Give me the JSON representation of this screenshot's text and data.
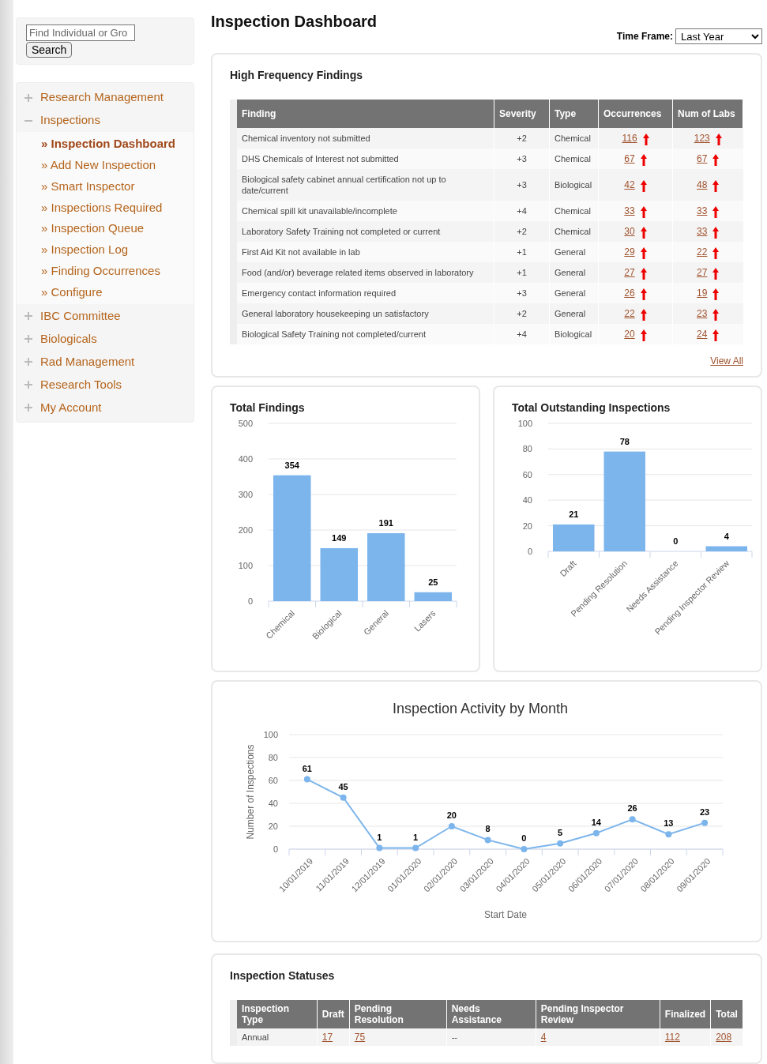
{
  "search": {
    "placeholder": "Find Individual or Gro",
    "button": "Search"
  },
  "sidebar": {
    "items": [
      {
        "label": "Research Management",
        "expanded": false
      },
      {
        "label": "Inspections",
        "expanded": true,
        "children": [
          {
            "label": "» Inspection Dashboard",
            "selected": true
          },
          {
            "label": "» Add New Inspection",
            "selected": false
          },
          {
            "label": "» Smart Inspector",
            "selected": false
          },
          {
            "label": "» Inspections Required",
            "selected": false
          },
          {
            "label": "» Inspection Queue",
            "selected": false
          },
          {
            "label": "» Inspection Log",
            "selected": false
          },
          {
            "label": "» Finding Occurrences",
            "selected": false
          },
          {
            "label": "» Configure",
            "selected": false
          }
        ]
      },
      {
        "label": "IBC Committee",
        "expanded": false
      },
      {
        "label": "Biologicals",
        "expanded": false
      },
      {
        "label": "Rad Management",
        "expanded": false
      },
      {
        "label": "Research Tools",
        "expanded": false
      },
      {
        "label": "My Account",
        "expanded": false
      }
    ]
  },
  "page_title": "Inspection Dashboard",
  "time_frame": {
    "label": "Time Frame:",
    "value": "Last Year"
  },
  "findings": {
    "title": "High Frequency Findings",
    "columns": [
      "Finding",
      "Severity",
      "Type",
      "Occurrences",
      "Num of Labs"
    ],
    "rows": [
      {
        "finding": "Chemical inventory not submitted",
        "severity": "+2",
        "type": "Chemical",
        "occurrences": "116",
        "labs": "123"
      },
      {
        "finding": "DHS Chemicals of Interest not submitted",
        "severity": "+3",
        "type": "Chemical",
        "occurrences": "67",
        "labs": "67"
      },
      {
        "finding": "Biological safety cabinet annual certification not up to date/current",
        "severity": "+3",
        "type": "Biological",
        "occurrences": "42",
        "labs": "48"
      },
      {
        "finding": "Chemical spill kit unavailable/incomplete",
        "severity": "+4",
        "type": "Chemical",
        "occurrences": "33",
        "labs": "33"
      },
      {
        "finding": "Laboratory Safety Training not completed or current",
        "severity": "+2",
        "type": "Chemical",
        "occurrences": "30",
        "labs": "33"
      },
      {
        "finding": "First Aid Kit not available in lab",
        "severity": "+1",
        "type": "General",
        "occurrences": "29",
        "labs": "22"
      },
      {
        "finding": "Food (and/or) beverage related items observed in laboratory",
        "severity": "+1",
        "type": "General",
        "occurrences": "27",
        "labs": "27"
      },
      {
        "finding": "Emergency contact information required",
        "severity": "+3",
        "type": "General",
        "occurrences": "26",
        "labs": "19"
      },
      {
        "finding": "General laboratory housekeeping un satisfactory",
        "severity": "+2",
        "type": "General",
        "occurrences": "22",
        "labs": "23"
      },
      {
        "finding": "Biological Safety Training not completed/current",
        "severity": "+4",
        "type": "Biological",
        "occurrences": "20",
        "labs": "24"
      }
    ],
    "view_all": "View All"
  },
  "total_findings": {
    "title": "Total Findings",
    "chart_data": {
      "type": "bar",
      "categories": [
        "Chemical",
        "Biological",
        "General",
        "Lasers"
      ],
      "series": [
        {
          "color": "#7cb5ec",
          "values": [
            354,
            149,
            191,
            25
          ]
        }
      ],
      "ylim": [
        0,
        500
      ],
      "yticks": [
        0,
        100,
        200,
        300,
        400,
        500
      ],
      "grid": true,
      "data_labels": true
    }
  },
  "outstanding": {
    "title": "Total Outstanding Inspections",
    "chart_data": {
      "type": "bar",
      "categories": [
        "Draft",
        "Pending Resolution",
        "Needs Assistance",
        "Pending Inspector Review"
      ],
      "series": [
        {
          "color": "#7cb5ec",
          "values": [
            21,
            78,
            0,
            4
          ]
        }
      ],
      "ylim": [
        0,
        100
      ],
      "yticks": [
        0,
        20,
        40,
        60,
        80,
        100
      ],
      "grid": true,
      "data_labels": true
    }
  },
  "activity": {
    "chart_data": {
      "type": "line",
      "title": "Inspection Activity by Month",
      "xlabel": "Start Date",
      "ylabel": "Number of Inspections",
      "categories": [
        "10/01/2019",
        "11/01/2019",
        "12/01/2019",
        "01/01/2020",
        "02/01/2020",
        "03/01/2020",
        "04/01/2020",
        "05/01/2020",
        "06/01/2020",
        "07/01/2020",
        "08/01/2020",
        "09/01/2020"
      ],
      "series": [
        {
          "color": "#7cb5ec",
          "marker": true,
          "values": [
            61,
            45,
            1,
            1,
            20,
            8,
            0,
            5,
            14,
            26,
            13,
            23
          ]
        }
      ],
      "ylim": [
        0,
        100
      ],
      "yticks": [
        0,
        20,
        40,
        60,
        80,
        100
      ],
      "grid": true,
      "data_labels": true
    }
  },
  "statuses": {
    "title": "Inspection Statuses",
    "columns": [
      "Inspection Type",
      "Draft",
      "Pending Resolution",
      "Needs Assistance",
      "Pending Inspector Review",
      "Finalized",
      "Total"
    ],
    "rows": [
      {
        "cells": [
          {
            "text": "Annual",
            "link": false
          },
          {
            "text": "17",
            "link": true
          },
          {
            "text": "75",
            "link": true
          },
          {
            "text": "--",
            "link": false
          },
          {
            "text": "4",
            "link": true
          },
          {
            "text": "112",
            "link": true
          },
          {
            "text": "208",
            "link": true
          }
        ]
      }
    ]
  }
}
